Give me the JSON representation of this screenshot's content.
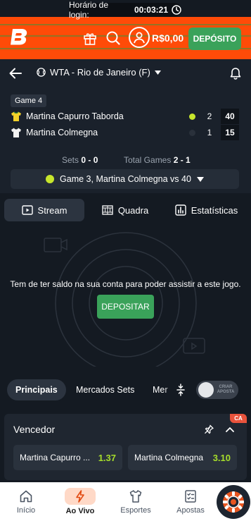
{
  "login_timer": {
    "label": "Horário de login:",
    "value": "00:03:21"
  },
  "header": {
    "balance": "R$0,00",
    "deposit_label": "DEPÓSITO"
  },
  "event": {
    "league": "WTA - Rio de Janeiro (F)"
  },
  "score": {
    "game_tag": "Game 4",
    "players": [
      {
        "name": "Martina Capurro Taborda",
        "sets": "2",
        "points": "40",
        "serving": true
      },
      {
        "name": "Martina Colmegna",
        "sets": "1",
        "points": "15",
        "serving": false
      }
    ],
    "sets_label": "Sets",
    "sets_value": "0 - 0",
    "total_games_label": "Total Games",
    "total_games_value": "2 - 1",
    "current_game": "Game 3, Martina Colmegna vs 40"
  },
  "tabs": [
    {
      "label": "Stream",
      "icon": "play-screen-icon",
      "active": true
    },
    {
      "label": "Quadra",
      "icon": "court-icon",
      "active": false
    },
    {
      "label": "Estatísticas",
      "icon": "stats-icon",
      "active": false
    }
  ],
  "stream": {
    "message": "Tem de ter saldo na sua conta para poder assistir a este jogo.",
    "deposit_cta": "DEPOSITAR"
  },
  "market_tabs": [
    {
      "label": "Principais",
      "active": true
    },
    {
      "label": "Mercados Sets",
      "active": false
    },
    {
      "label": "Mer",
      "active": false
    }
  ],
  "toggle": {
    "label": "CRIAR APOSTA",
    "on": false
  },
  "market": {
    "title": "Vencedor",
    "badge": "CA",
    "odds": [
      {
        "name": "Martina Capurro ...",
        "value": "1.37"
      },
      {
        "name": "Martina Colmegna",
        "value": "3.10"
      }
    ]
  },
  "bottom_nav": [
    {
      "label": "Início",
      "icon": "home-icon",
      "active": false
    },
    {
      "label": "Ao Vivo",
      "icon": "lightning-icon",
      "active": true
    },
    {
      "label": "Esportes",
      "icon": "jersey-icon",
      "active": false
    },
    {
      "label": "Apostas",
      "icon": "betslip-icon",
      "active": false
    }
  ],
  "colors": {
    "brand": "#ff4b08",
    "accent_green": "#3aa25a",
    "odds_value": "#a6dd2b",
    "background": "#141a22",
    "panel": "#1a212b"
  }
}
